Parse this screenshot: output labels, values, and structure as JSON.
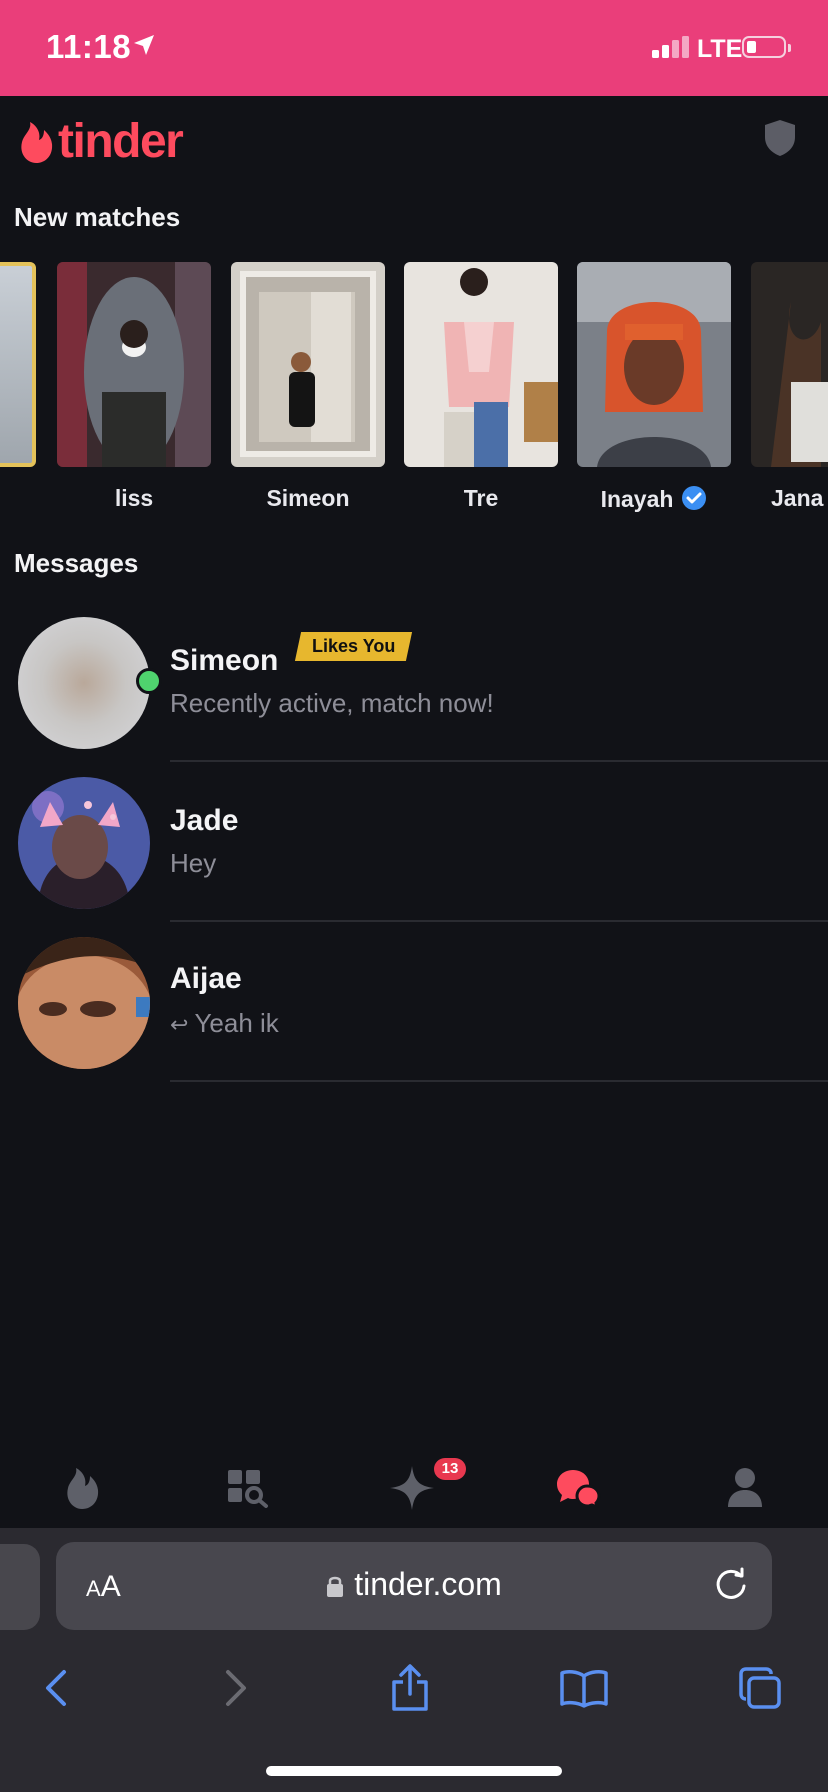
{
  "status_bar": {
    "time": "11:18",
    "network": "LTE"
  },
  "app": {
    "logo": "tinder"
  },
  "sections": {
    "new_matches": "New matches",
    "messages": "Messages"
  },
  "new_matches": [
    {
      "name": ""
    },
    {
      "name": "liss"
    },
    {
      "name": "Simeon"
    },
    {
      "name": "Tre"
    },
    {
      "name": "Inayah",
      "verified": true
    },
    {
      "name": "Jana"
    }
  ],
  "messages": [
    {
      "name": "Simeon",
      "badge": "Likes You",
      "preview": "Recently active, match now!",
      "online": true
    },
    {
      "name": "Jade",
      "preview": "Hey"
    },
    {
      "name": "Aijae",
      "preview": "Yeah ik",
      "replied": true
    }
  ],
  "tabbar": {
    "items": [
      "flame-icon",
      "explore-icon",
      "sparkle-icon",
      "chat-icon",
      "profile-icon"
    ],
    "active": "chat-icon",
    "sparkle_badge": "13"
  },
  "browser": {
    "text_size_label": "AA",
    "url": "tinder.com"
  },
  "colors": {
    "brand": "#fe4b5e",
    "status_bar": "#ea3e7a",
    "badge": "#e7b72e",
    "background": "#111217",
    "link_blue": "#5a8ff0"
  }
}
